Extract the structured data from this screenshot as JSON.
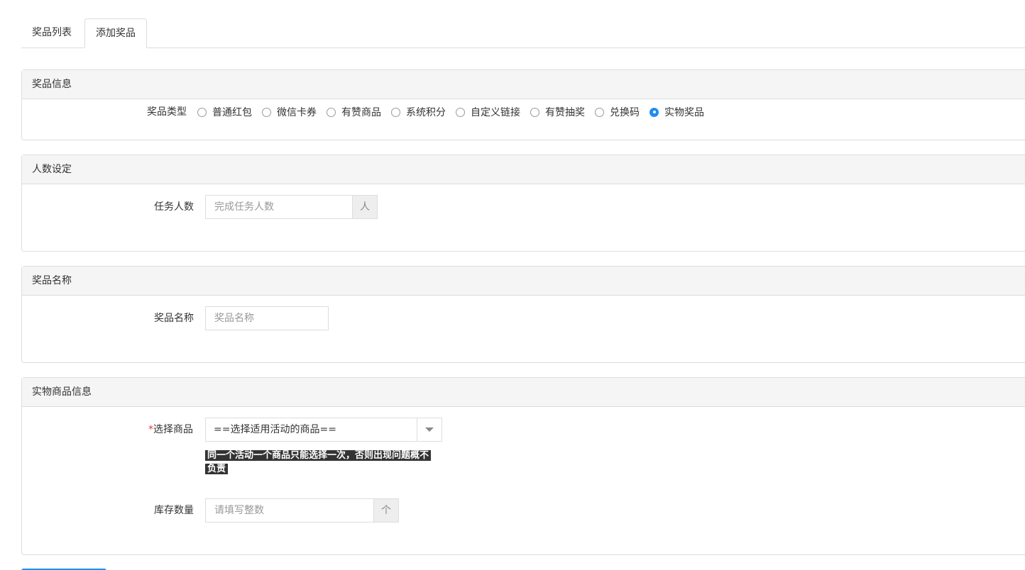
{
  "tabs": [
    {
      "label": "奖品列表",
      "active": false
    },
    {
      "label": "添加奖品",
      "active": true
    }
  ],
  "prize_info": {
    "title": "奖品信息",
    "type_label": "奖品类型",
    "options": [
      {
        "label": "普通红包",
        "checked": false
      },
      {
        "label": "微信卡券",
        "checked": false
      },
      {
        "label": "有赞商品",
        "checked": false
      },
      {
        "label": "系统积分",
        "checked": false
      },
      {
        "label": "自定义链接",
        "checked": false
      },
      {
        "label": "有赞抽奖",
        "checked": false
      },
      {
        "label": "兑换码",
        "checked": false
      },
      {
        "label": "实物奖品",
        "checked": true
      }
    ]
  },
  "people": {
    "title": "人数设定",
    "label": "任务人数",
    "placeholder": "完成任务人数",
    "value": "",
    "unit": "人"
  },
  "prize_name": {
    "title": "奖品名称",
    "label": "奖品名称",
    "placeholder": "奖品名称",
    "value": ""
  },
  "goods": {
    "title": "实物商品信息",
    "required_mark": "*",
    "select_label": "选择商品",
    "select_value": "==选择适用活动的商品==",
    "tip": "同一个活动一个商品只能选择一次，否则出现问题概不负责",
    "stock_label": "库存数量",
    "stock_placeholder": "请填写整数",
    "stock_value": "",
    "stock_addon": "个"
  },
  "colors": {
    "accent": "#1c8ef2",
    "required": "#e4393c",
    "panel_header_bg": "#f5f5f5",
    "border": "#dddddd",
    "tip_bg": "#333333"
  }
}
